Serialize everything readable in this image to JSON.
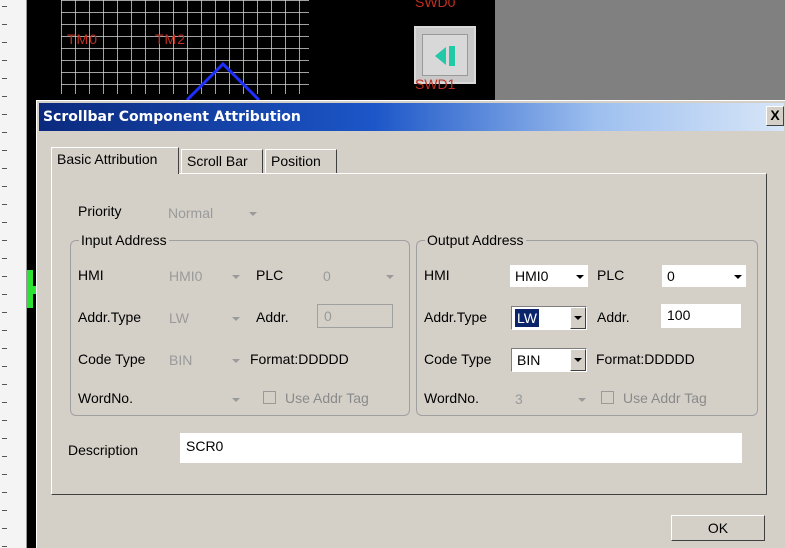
{
  "editor": {
    "labels": {
      "tm0": "TM0",
      "tm2": "TM2",
      "swd0": "SWD0",
      "swd1": "SWD1"
    },
    "accent_color": "#22c9a8",
    "icons": {
      "switch": "left-arrow-switch-icon"
    }
  },
  "dialog": {
    "title": "Scrollbar Component Attribution",
    "close_label": "X",
    "tabs": [
      "Basic Attribution",
      "Scroll Bar",
      "Position"
    ],
    "active_tab": "Basic Attribution",
    "priority": {
      "label": "Priority",
      "value": "Normal"
    },
    "input_address": {
      "legend": "Input Address",
      "hmi_label": "HMI",
      "hmi_value": "HMI0",
      "plc_label": "PLC",
      "plc_value": "0",
      "addr_type_label": "Addr.Type",
      "addr_type_value": "LW",
      "addr_label": "Addr.",
      "addr_value": "0",
      "code_type_label": "Code Type",
      "code_type_value": "BIN",
      "format_text": "Format:DDDDD",
      "word_no_label": "WordNo.",
      "word_no_value": "",
      "use_addr_tag_label": "Use Addr Tag"
    },
    "output_address": {
      "legend": "Output Address",
      "hmi_label": "HMI",
      "hmi_value": "HMI0",
      "plc_label": "PLC",
      "plc_value": "0",
      "addr_type_label": "Addr.Type",
      "addr_type_value": "LW",
      "addr_label": "Addr.",
      "addr_value": "100",
      "code_type_label": "Code Type",
      "code_type_value": "BIN",
      "format_text": "Format:DDDDD",
      "word_no_label": "WordNo.",
      "word_no_value": "3",
      "use_addr_tag_label": "Use Addr Tag"
    },
    "description": {
      "label": "Description",
      "value": "SCR0"
    },
    "ok_label": "OK"
  }
}
